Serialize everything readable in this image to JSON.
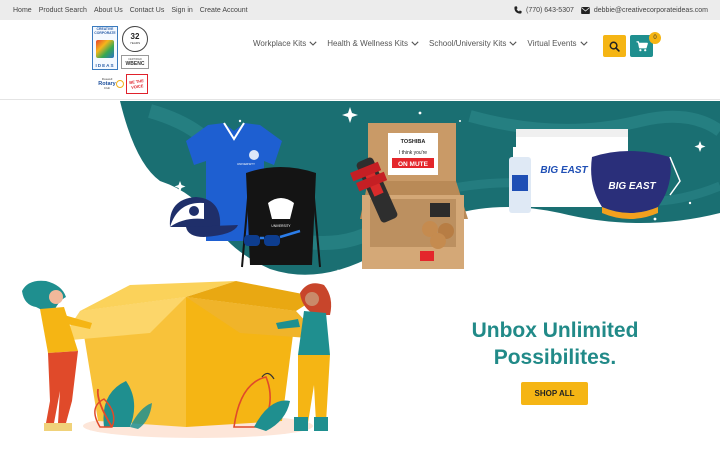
{
  "topbar": {
    "links": [
      "Home",
      "Product Search",
      "About Us",
      "Contact Us",
      "Sign in",
      "Create Account"
    ],
    "phone": "(770) 643-5307",
    "email": "debbie@creativecorporateideas.com"
  },
  "logos": {
    "brand_top": "CREATIVE CORPORATE",
    "brand_bottom": "IDEAS",
    "anniversary_number": "32",
    "anniversary_label": "YEARS",
    "wbenc_caption": "CERTIFIED",
    "wbenc": "WBENC",
    "rotary_small": "Roswell",
    "rotary": "Rotary",
    "rotary_club": "Club",
    "voice": "BE THE VOICE"
  },
  "nav": [
    {
      "label": "Workplace Kits"
    },
    {
      "label": "Health & Wellness Kits"
    },
    {
      "label": "School/University Kits"
    },
    {
      "label": "Virtual Events"
    }
  ],
  "cart": {
    "count": "0"
  },
  "hero": {
    "headline_line1": "Unbox Unlimited",
    "headline_line2": "Possibilites.",
    "cta": "SHOP ALL",
    "polo_print": "UNIVERSITY",
    "bag_print": "UNIVERSITY",
    "box_label_brand": "TOSHIBA",
    "box_label_line1": "I think you're",
    "box_label_line2": "ON MUTE",
    "mask_brand": "BIG EAST",
    "pouch_brand": "BIG EAST"
  },
  "colors": {
    "teal": "#218a88",
    "teal_dark": "#1a6f72",
    "yellow": "#f5b514",
    "topbar": "#ececec"
  }
}
